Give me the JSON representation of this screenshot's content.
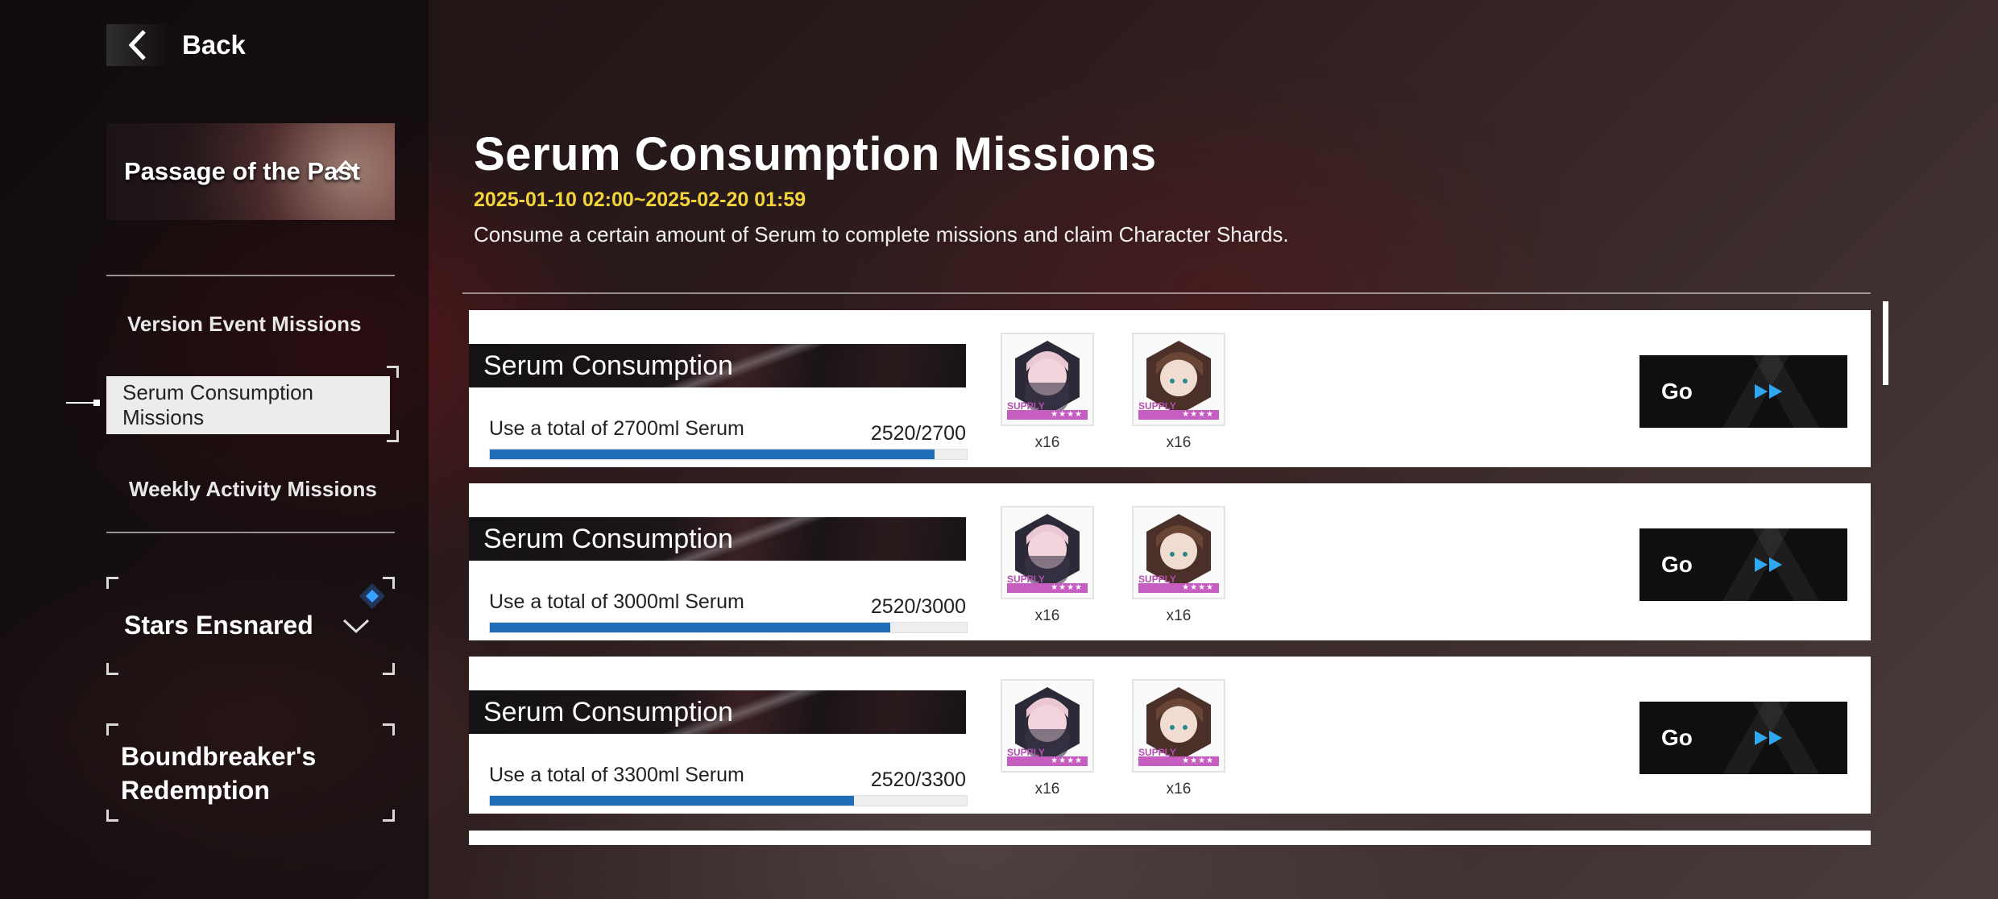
{
  "header": {
    "back_label": "Back"
  },
  "sidebar": {
    "event_banner_title": "Passage of the Past",
    "nav_items": [
      {
        "label": "Version Event Missions",
        "active": false
      },
      {
        "label": "Serum Consumption Missions",
        "active": true
      },
      {
        "label": "Weekly Activity Missions",
        "active": false
      }
    ],
    "groups": [
      {
        "title": "Stars Ensnared"
      },
      {
        "title": "Boundbreaker's Redemption"
      }
    ]
  },
  "main": {
    "title": "Serum Consumption Missions",
    "date_range": "2025-01-10 02:00~2025-02-20 01:59",
    "description": "Consume a certain amount of Serum to complete missions and claim Character Shards.",
    "missions": [
      {
        "name": "Serum Consumption",
        "requirement": "Use a total of 2700ml Serum",
        "progress_text": "2520/2700",
        "progress_fraction": 0.933,
        "rewards": [
          {
            "qty": "x16",
            "rarity": "★★★★",
            "tag": "SUPPLY"
          },
          {
            "qty": "x16",
            "rarity": "★★★★",
            "tag": "SUPPLY"
          }
        ],
        "button_label": "Go"
      },
      {
        "name": "Serum Consumption",
        "requirement": "Use a total of 3000ml Serum",
        "progress_text": "2520/3000",
        "progress_fraction": 0.84,
        "rewards": [
          {
            "qty": "x16",
            "rarity": "★★★★",
            "tag": "SUPPLY"
          },
          {
            "qty": "x16",
            "rarity": "★★★★",
            "tag": "SUPPLY"
          }
        ],
        "button_label": "Go"
      },
      {
        "name": "Serum Consumption",
        "requirement": "Use a total of 3300ml Serum",
        "progress_text": "2520/3300",
        "progress_fraction": 0.764,
        "rewards": [
          {
            "qty": "x16",
            "rarity": "★★★★",
            "tag": "SUPPLY"
          },
          {
            "qty": "x16",
            "rarity": "★★★★",
            "tag": "SUPPLY"
          }
        ],
        "button_label": "Go"
      }
    ]
  },
  "colors": {
    "accent_yellow": "#f3d43a",
    "progress_blue": "#1f6fb8",
    "rarity_purple": "#c65dc0",
    "go_arrow_blue": "#2fa8f0",
    "indicator_blue": "#2a7fe0"
  },
  "icons": {
    "back": "chevron-left-icon",
    "banner_toggle": "chevron-up-icon",
    "group_toggle": "chevron-down-icon",
    "group_badge": "diamond-icon",
    "go": "double-arrow-icon"
  }
}
